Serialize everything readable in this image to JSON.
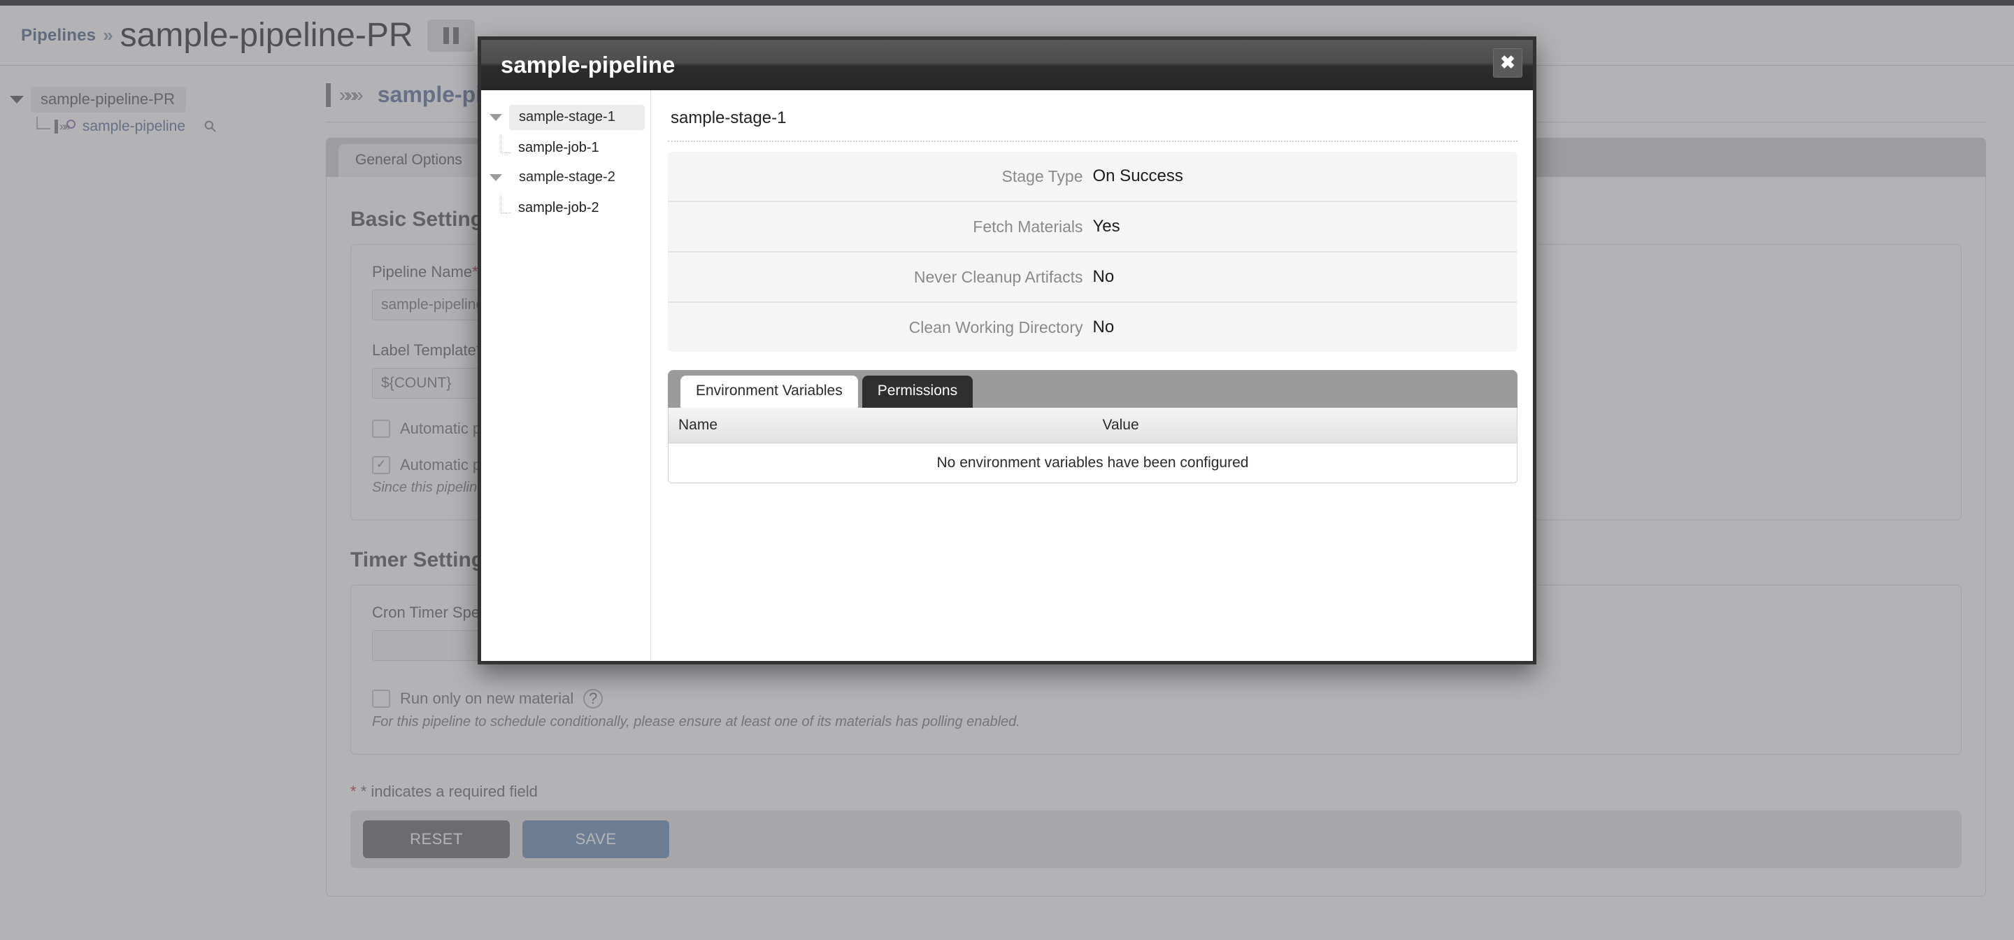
{
  "background": {
    "breadcrumb": {
      "root": "Pipelines",
      "separator": "»",
      "current": "sample-pipeline-PR"
    },
    "pause_button": {
      "icon": "pause-icon"
    },
    "sidebar": {
      "root_label": "sample-pipeline-PR",
      "child_label": "sample-pipeline",
      "search_icon": "search-icon"
    },
    "main": {
      "title": "sample-pipeline",
      "tabs": [
        {
          "label": "General Options"
        }
      ],
      "basic_settings": {
        "heading": "Basic Settings",
        "pipeline_name_label": "Pipeline Name",
        "pipeline_name_value": "sample-pipeline-PR",
        "label_template_label": "Label Template",
        "label_template_value": "${COUNT}",
        "checkbox_1_label": "Automatic pipeline scheduling",
        "checkbox_2_label": "Automatic pipeline locking",
        "locking_note": "Since this pipeline is a part of one or more environments, it is automatically locked."
      },
      "timer_settings": {
        "heading": "Timer Settings",
        "cron_label": "Cron Timer Specification",
        "cron_value": "",
        "run_only_new_material_label": "Run only on new material",
        "polling_note": "For this pipeline to schedule conditionally, please ensure at least one of its materials has polling enabled.",
        "help_icon": "question-mark-icon"
      },
      "required_note": "* indicates a required field",
      "buttons": {
        "reset": "RESET",
        "save": "SAVE"
      }
    }
  },
  "modal": {
    "title": "sample-pipeline",
    "close_icon": "close-icon",
    "tree": [
      {
        "type": "stage",
        "label": "sample-stage-1",
        "selected": true,
        "caret": "chevron-down-icon"
      },
      {
        "type": "job",
        "label": "sample-job-1",
        "selected": false
      },
      {
        "type": "stage",
        "label": "sample-stage-2",
        "selected": false,
        "caret": "chevron-down-icon"
      },
      {
        "type": "job",
        "label": "sample-job-2",
        "selected": false
      }
    ],
    "detail": {
      "heading": "sample-stage-1",
      "rows": [
        {
          "key": "Stage Type",
          "value": "On Success"
        },
        {
          "key": "Fetch Materials",
          "value": "Yes"
        },
        {
          "key": "Never Cleanup Artifacts",
          "value": "No"
        },
        {
          "key": "Clean Working Directory",
          "value": "No"
        }
      ]
    },
    "tabs": [
      {
        "label": "Environment Variables",
        "active": true
      },
      {
        "label": "Permissions",
        "active": false
      }
    ],
    "env_table": {
      "columns": [
        "Name",
        "Value"
      ],
      "empty_message": "No environment variables have been configured",
      "rows": []
    }
  },
  "colors": {
    "modal_border": "#333333",
    "modal_header_dark": "#262626",
    "tabstrip_gray": "#9b9b9b",
    "accent_link": "#7384a8",
    "save_button": "#7e9ec0",
    "required_star": "#c25b5b",
    "overlay": "rgba(90,90,96,0.46)"
  }
}
